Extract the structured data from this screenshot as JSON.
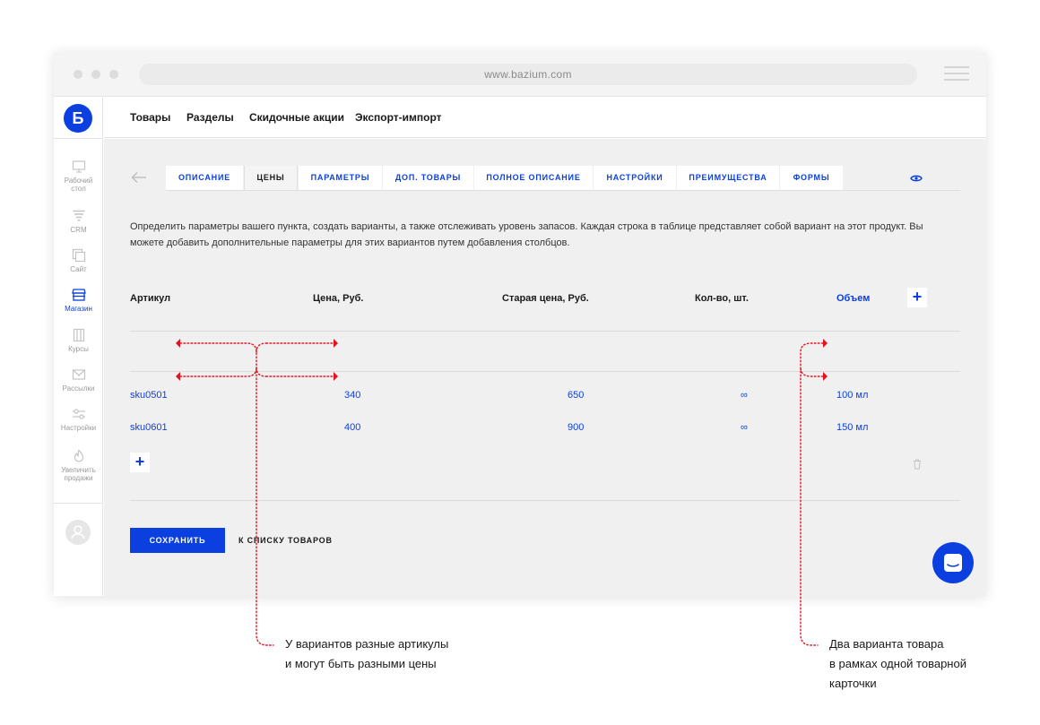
{
  "browser": {
    "url": "www.bazium.com"
  },
  "sidebar": {
    "logo": "Б",
    "items": [
      {
        "label_lines": [
          "Рабочий",
          "стол"
        ],
        "icon": "desktop-icon",
        "active": false
      },
      {
        "label_lines": [
          "CRM"
        ],
        "icon": "funnel-icon",
        "active": false
      },
      {
        "label_lines": [
          "Сайт"
        ],
        "icon": "site-icon",
        "active": false
      },
      {
        "label_lines": [
          "Магазин"
        ],
        "icon": "shop-icon",
        "active": true
      },
      {
        "label_lines": [
          "Курсы"
        ],
        "icon": "courses-icon",
        "active": false
      },
      {
        "label_lines": [
          "Рассылки"
        ],
        "icon": "mail-icon",
        "active": false
      },
      {
        "label_lines": [
          "Настройки"
        ],
        "icon": "sliders-icon",
        "active": false
      },
      {
        "label_lines": [
          "Увеличить",
          "продажи"
        ],
        "icon": "fire-icon",
        "active": false
      }
    ]
  },
  "topnav": [
    "Товары",
    "Разделы",
    "Скидочные акции",
    "Экспорт-импорт"
  ],
  "tabs": [
    {
      "label": "ОПИСАНИЕ",
      "active": false
    },
    {
      "label": "ЦЕНЫ",
      "active": true
    },
    {
      "label": "ПАРАМЕТРЫ",
      "active": false
    },
    {
      "label": "ДОП. ТОВАРЫ",
      "active": false
    },
    {
      "label": "ПОЛНОЕ ОПИСАНИЕ",
      "active": false
    },
    {
      "label": "НАСТРОЙКИ",
      "active": false
    },
    {
      "label": "ПРЕИМУЩЕСТВА",
      "active": false
    },
    {
      "label": "ФОРМЫ",
      "active": false
    }
  ],
  "description": "Определить параметры вашего пункта, создать варианты, а также отслеживать уровень запасов. Каждая строка в таблице представляет собой вариант на этот продукт. Вы можете добавить дополнительные параметры для этих вариантов путем добавления столбцов.",
  "table": {
    "headers": {
      "sku": "Артикул",
      "price": "Цена, Руб.",
      "old_price": "Старая цена, Руб.",
      "qty": "Кол-во, шт.",
      "volume": "Объем"
    },
    "rows": [
      {
        "sku": "sku0501",
        "price": "340",
        "old_price": "650",
        "qty": "∞",
        "volume": "100 мл"
      },
      {
        "sku": "sku0601",
        "price": "400",
        "old_price": "900",
        "qty": "∞",
        "volume": "150 мл"
      }
    ],
    "add_symbol": "+"
  },
  "actions": {
    "save": "СОХРАНИТЬ",
    "back_to_list": "К СПИСКУ ТОВАРОВ"
  },
  "annotations": {
    "left": [
      "У вариантов разные артикулы",
      "и могут быть разными цены"
    ],
    "right": [
      "Два варианта товара",
      "в рамках одной товарной",
      "карточки"
    ]
  },
  "colors": {
    "accent": "#0b3fe0",
    "annotation": "#e0141e",
    "panel": "#f0f0f0"
  }
}
